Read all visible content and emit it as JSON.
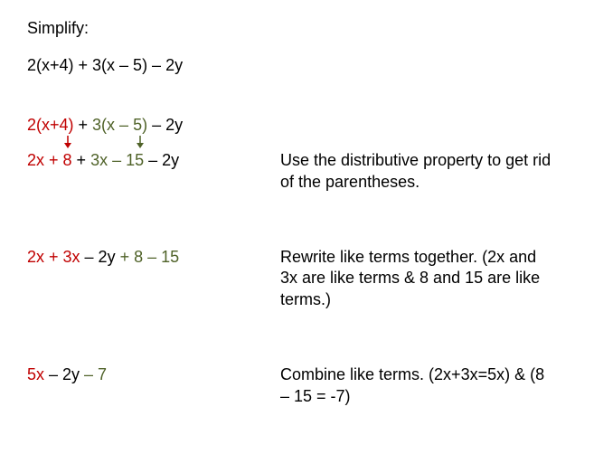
{
  "title": "Simplify:",
  "problem": "2(x+4) + 3(x – 5) – 2y",
  "step1": {
    "expr_red": "2(x+4)",
    "expr_plus1": " + ",
    "expr_green": "3(x – 5)",
    "expr_tail": " – 2y"
  },
  "step1b": {
    "red": "2x + 8",
    "plus": " + ",
    "green": "3x – 15",
    "tail": " – 2y"
  },
  "desc1": "Use the distributive property to get rid of the parentheses.",
  "step2": {
    "red": "2x + 3x",
    "mid": " – 2y ",
    "green": "+ 8 – 15"
  },
  "desc2": "Rewrite like terms together.  (2x and 3x are like terms & 8 and 15 are like terms.)",
  "step3": {
    "red": "5x",
    "mid": " – 2y ",
    "green": "– 7"
  },
  "desc3": "Combine like terms.  (2x+3x=5x) & (8 – 15 = -7)",
  "colors": {
    "red": "#c00000",
    "green": "#4f6228",
    "black": "#000000"
  }
}
